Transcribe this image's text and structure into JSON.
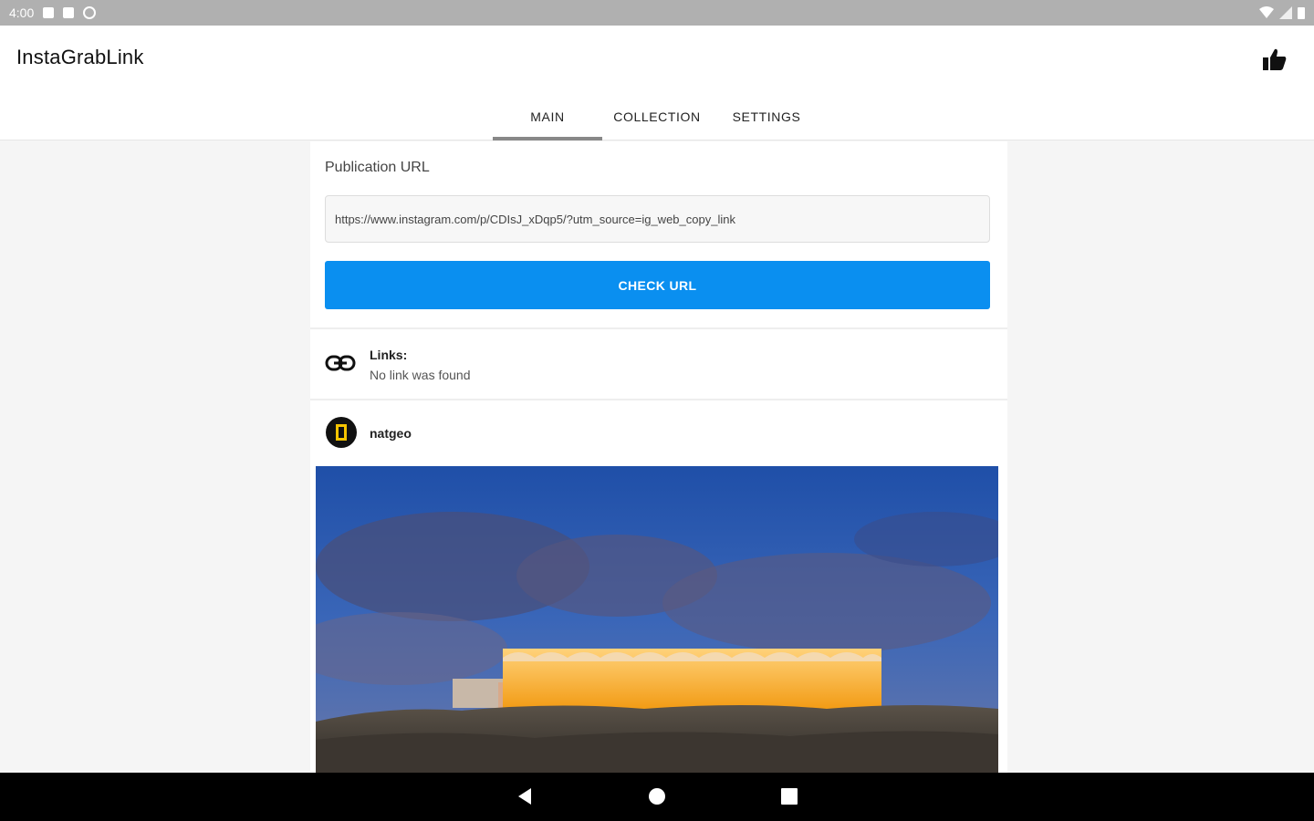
{
  "status_bar": {
    "time": "4:00"
  },
  "app": {
    "title": "InstaGrabLink"
  },
  "tabs": [
    {
      "label": "MAIN",
      "active": true
    },
    {
      "label": "COLLECTION",
      "active": false
    },
    {
      "label": "SETTINGS",
      "active": false
    }
  ],
  "form": {
    "label": "Publication URL",
    "url_value": "https://www.instagram.com/p/CDIsJ_xDqp5/?utm_source=ig_web_copy_link",
    "check_button": "CHECK URL"
  },
  "links": {
    "title": "Links:",
    "status": "No link was found"
  },
  "post": {
    "username": "natgeo"
  },
  "colors": {
    "accent": "#0a8ff0",
    "tab_indicator": "#888888",
    "avatar_frame": "#f5c400"
  },
  "icons": [
    "thumb-up-icon",
    "link-icon",
    "back-icon",
    "home-icon",
    "recents-icon"
  ]
}
